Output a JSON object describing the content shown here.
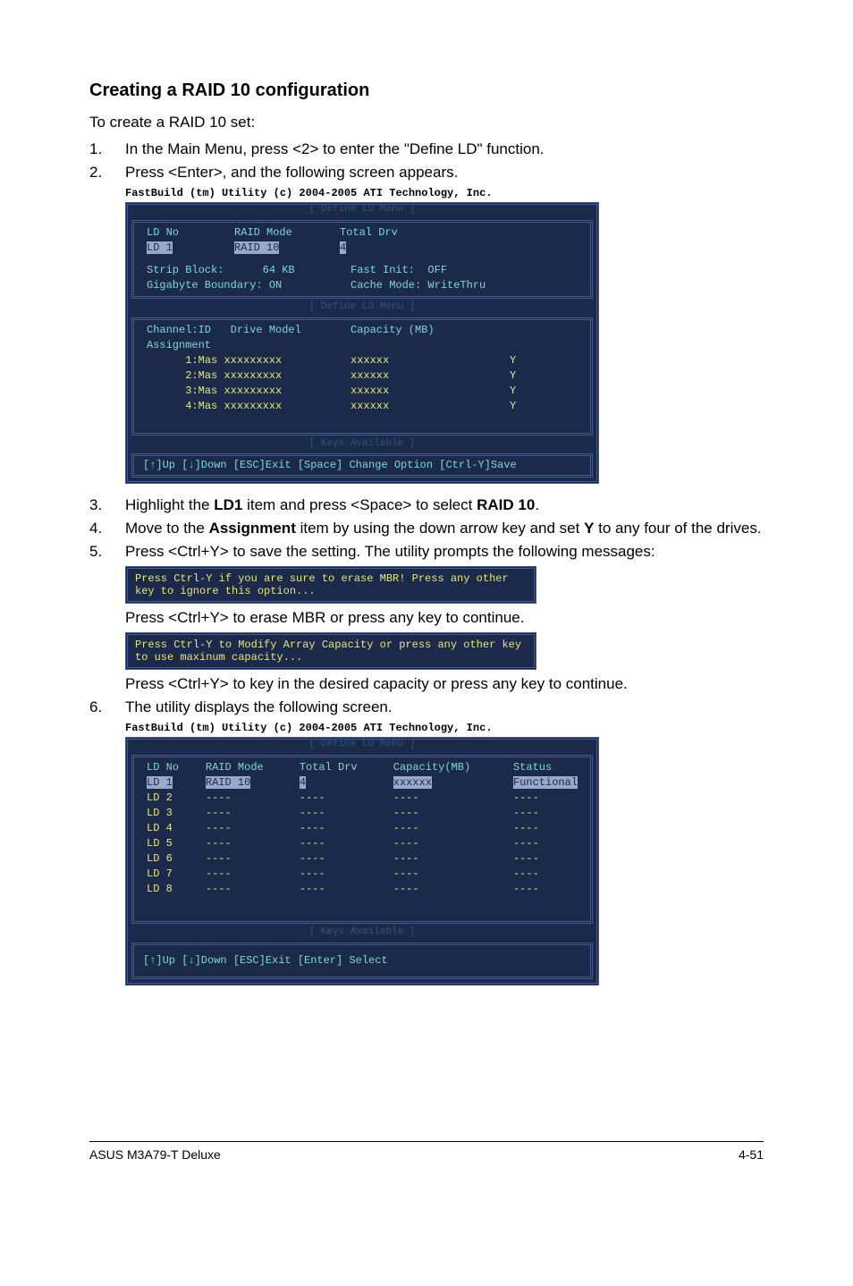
{
  "heading": "Creating a RAID 10 configuration",
  "intro": "To create a RAID 10 set:",
  "steps": {
    "s1": "In the Main Menu, press <2> to enter the \"Define LD\" function.",
    "s2": "Press <Enter>, and the following screen appears.",
    "s3": "Highlight the LD1 item and press <Space> to select RAID 10.",
    "s3_prefix": "Highlight the ",
    "s3_b1": "LD1",
    "s3_mid": " item and press <Space> to select ",
    "s3_b2": "RAID 10",
    "s3_suffix": ".",
    "s4_prefix": "Move to the ",
    "s4_b1": "Assignment",
    "s4_mid": " item by using the down arrow key and set ",
    "s4_b2": "Y",
    "s4_suffix": " to any four of the drives.",
    "s5": "Press <Ctrl+Y> to save the setting. The utility prompts the following messages:",
    "s6": "The utility displays the following screen."
  },
  "sub1": "Press <Ctrl+Y> to erase MBR or press any key to continue.",
  "sub2": "Press <Ctrl+Y> to key in the desired capacity or press any key to continue.",
  "term1": {
    "title": "FastBuild (tm) Utility (c) 2004-2005 ATI Technology, Inc.",
    "menu1_label": "[ Define LD Menu ]",
    "hdr_ldno": "LD No",
    "hdr_raidmode": "RAID Mode",
    "hdr_totaldrv": "Total Drv",
    "row_ld": "LD 1",
    "row_mode": "RAID 10",
    "row_drv": "4",
    "strip": "Strip Block:      64 KB",
    "fastinit": "Fast Init:  OFF",
    "gig": "Gigabyte Boundary: ON",
    "cache": "Cache Mode: WriteThru",
    "menu2_label": "[ Define LD Menu ]",
    "hdr_chan": "Channel:ID   Drive Model",
    "hdr_cap": "Capacity (MB)",
    "hdr_asg": "Assignment",
    "drives": [
      {
        "id": "1:Mas",
        "model": "xxxxxxxxx",
        "cap": "xxxxxx",
        "asg": "Y"
      },
      {
        "id": "2:Mas",
        "model": "xxxxxxxxx",
        "cap": "xxxxxx",
        "asg": "Y"
      },
      {
        "id": "3:Mas",
        "model": "xxxxxxxxx",
        "cap": "xxxxxx",
        "asg": "Y"
      },
      {
        "id": "4:Mas",
        "model": "xxxxxxxxx",
        "cap": "xxxxxx",
        "asg": "Y"
      }
    ],
    "keys_label": "[ Keys Available ]",
    "keys": "[↑]Up   [↓]Down   [ESC]Exit     [Space] Change Option     [Ctrl-Y]Save"
  },
  "msg1": "Press Ctrl-Y if you are sure to erase MBR! Press any other key to ignore this option...",
  "msg2": "Press Ctrl-Y to Modify Array Capacity or press any other key to use maxinum capacity...",
  "term2": {
    "title": "FastBuild (tm) Utility (c) 2004-2005 ATI Technology, Inc.",
    "menu_label": "[ Define LD Menu ]",
    "hdr_ldno": "LD No",
    "hdr_mode": "RAID Mode",
    "hdr_drv": "Total Drv",
    "hdr_cap": "Capacity(MB)",
    "hdr_stat": "Status",
    "rows": [
      {
        "ld": "LD 1",
        "mode": "RAID 10",
        "drv": "4",
        "cap": "xxxxxx",
        "stat": "Functional",
        "hl": true
      },
      {
        "ld": "LD 2",
        "mode": "----",
        "drv": "----",
        "cap": "----",
        "stat": "----"
      },
      {
        "ld": "LD 3",
        "mode": "----",
        "drv": "----",
        "cap": "----",
        "stat": "----"
      },
      {
        "ld": "LD 4",
        "mode": "----",
        "drv": "----",
        "cap": "----",
        "stat": "----"
      },
      {
        "ld": "LD 5",
        "mode": "----",
        "drv": "----",
        "cap": "----",
        "stat": "----"
      },
      {
        "ld": "LD 6",
        "mode": "----",
        "drv": "----",
        "cap": "----",
        "stat": "----"
      },
      {
        "ld": "LD 7",
        "mode": "----",
        "drv": "----",
        "cap": "----",
        "stat": "----"
      },
      {
        "ld": "LD 8",
        "mode": "----",
        "drv": "----",
        "cap": "----",
        "stat": "----"
      }
    ],
    "keys_label": "[ Keys Available ]",
    "keys": "[↑]Up     [↓]Down     [ESC]Exit   [Enter] Select"
  },
  "footer_left": "ASUS M3A79-T Deluxe",
  "footer_right": "4-51"
}
